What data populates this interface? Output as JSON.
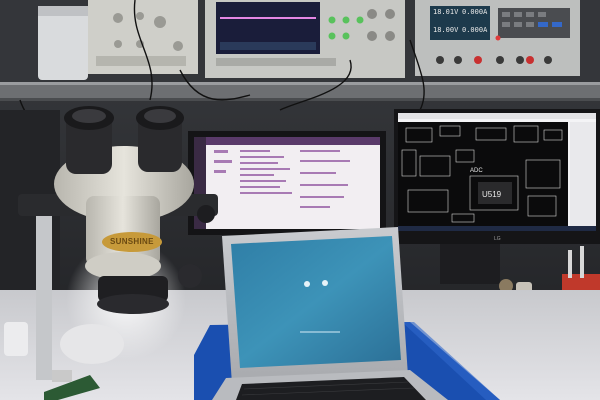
{
  "photo": {
    "power_supply_display": {
      "line1": "18.01V",
      "line2": "0.000A",
      "line3": "18.00V",
      "line4": "0.000A"
    },
    "microscope_brand": "SUNSHINE",
    "pcb_chip_label": "U519",
    "pcb_header_label": "ADC",
    "right_monitor_logo": "LG",
    "colors": {
      "laptop_screen": "#3a8ab0",
      "scope_trace": "#e070e0",
      "mat_blue": "#1a4fb0",
      "desk_surface": "#d8d8dc"
    }
  }
}
